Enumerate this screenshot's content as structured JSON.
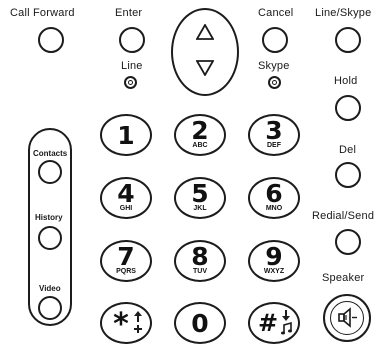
{
  "top_row": {
    "call_forward_label": "Call Forward",
    "enter_label": "Enter",
    "cancel_label": "Cancel",
    "line_skype_label": "Line/Skype",
    "line_led_label": "Line",
    "skype_led_label": "Skype"
  },
  "navigation": {
    "up_icon": "triangle-up-icon",
    "down_icon": "triangle-down-icon"
  },
  "right_column": {
    "hold_label": "Hold",
    "del_label": "Del",
    "redial_send_label": "Redial/Send",
    "speaker_label": "Speaker",
    "speaker_icon": "speaker-icon"
  },
  "left_column": {
    "contacts_label": "Contacts",
    "history_label": "History",
    "video_label": "Video"
  },
  "keypad": {
    "keys": [
      {
        "digit": "1",
        "letters": ""
      },
      {
        "digit": "2",
        "letters": "ABC"
      },
      {
        "digit": "3",
        "letters": "DEF"
      },
      {
        "digit": "4",
        "letters": "GHI"
      },
      {
        "digit": "5",
        "letters": "JKL"
      },
      {
        "digit": "6",
        "letters": "MNO"
      },
      {
        "digit": "7",
        "letters": "PQRS"
      },
      {
        "digit": "8",
        "letters": "TUV"
      },
      {
        "digit": "9",
        "letters": "WXYZ"
      },
      {
        "digit": "0",
        "letters": ""
      }
    ],
    "star_key": {
      "symbol": "*",
      "icon": "star-arrow-plus-icon"
    },
    "hash_key": {
      "symbol": "#",
      "icon": "hash-arrow-music-icon"
    }
  }
}
